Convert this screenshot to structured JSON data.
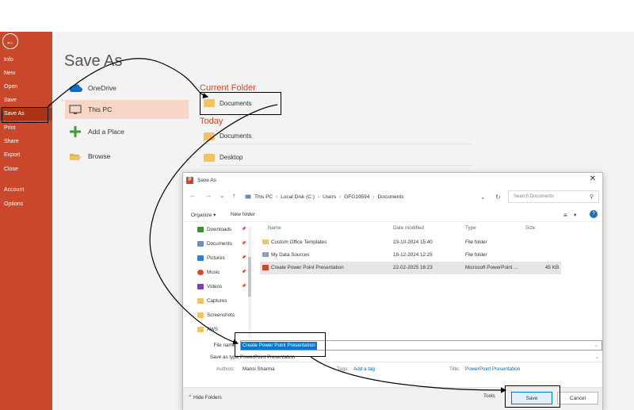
{
  "sidebar": {
    "back_icon": "arrow-left-icon",
    "items": [
      "Info",
      "New",
      "Open",
      "Save",
      "Save As",
      "Print",
      "Share",
      "Export",
      "Close",
      "Account",
      "Options"
    ],
    "active_index": 4,
    "color": "#c9472a"
  },
  "backstage": {
    "title": "Save As",
    "locations": [
      {
        "label": "OneDrive",
        "icon": "cloud-icon"
      },
      {
        "label": "This PC",
        "icon": "computer-icon"
      },
      {
        "label": "Add a Place",
        "icon": "plus-icon"
      },
      {
        "label": "Browse",
        "icon": "folder-open-icon"
      }
    ],
    "current_folder_header": "Current Folder",
    "current_folder": "Documents",
    "today_header": "Today",
    "today_folders": [
      "Documents",
      "Desktop"
    ],
    "accent": "#d24726"
  },
  "dialog": {
    "title": "Save As",
    "breadcrumb": [
      "This PC",
      "Local Disk (C:)",
      "Users",
      "GFG19594",
      "Documents"
    ],
    "search_placeholder": "Search Documents",
    "organize": "Organize ▾",
    "new_folder": "New folder",
    "nav_items": [
      {
        "label": "Downloads",
        "color": "#3a8f3a"
      },
      {
        "label": "Documents",
        "color": "#6d8fb3"
      },
      {
        "label": "Pictures",
        "color": "#2f7fcf"
      },
      {
        "label": "Music",
        "color": "#e0462e"
      },
      {
        "label": "Videos",
        "color": "#7a3fb5"
      },
      {
        "label": "Captures",
        "color": "#f2c460"
      },
      {
        "label": "Screenshots",
        "color": "#f2c460"
      },
      {
        "label": "AWS",
        "color": "#f2c460"
      }
    ],
    "columns": {
      "name": "Name",
      "date": "Date modified",
      "type": "Type",
      "size": "Size"
    },
    "files": [
      {
        "name": "Custom Office Templates",
        "date": "23-10-2024 15:40",
        "type": "File folder",
        "size": ""
      },
      {
        "name": "My Data Sources",
        "date": "19-12-2024 12:25",
        "type": "File folder",
        "size": ""
      },
      {
        "name": "Create Power Point Presentation",
        "date": "22-02-2025 16:23",
        "type": "Microsoft PowerPoint ...",
        "size": "45 KB"
      }
    ],
    "file_name_label": "File name:",
    "file_name_value": "Create Power Point Presentation",
    "save_type_label": "Save as type:",
    "save_type_value": "PowerPoint Presentation",
    "authors_label": "Authors:",
    "authors_value": "Mansi Sharma",
    "tags_label": "Tags:",
    "tags_value": "Add a tag",
    "title_label": "Title:",
    "title_value": "PowerPoint Presentation",
    "hide_folders": "Hide Folders",
    "tools": "Tools",
    "save_button": "Save",
    "cancel_button": "Cancel",
    "selection_color": "#0078d4"
  }
}
